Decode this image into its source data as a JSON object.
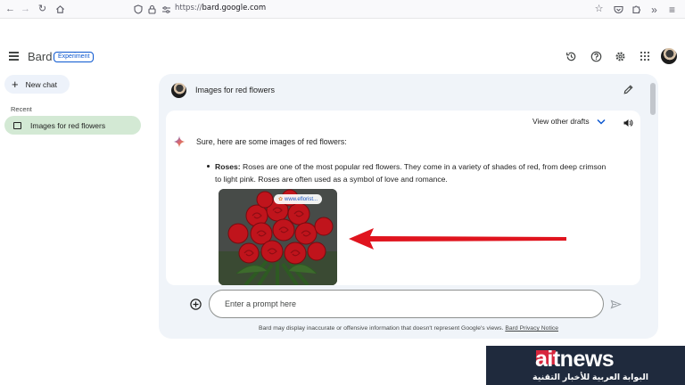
{
  "browser": {
    "url_prefix": "https://",
    "url_host": "bard.google.com",
    "icons": [
      "back-icon",
      "forward-icon",
      "reload-icon",
      "home-icon",
      "shield-icon",
      "lock-icon",
      "permissions-icon",
      "bookmark-star-icon",
      "pocket-icon",
      "extensions-icon",
      "overflow-icon",
      "menu-icon"
    ]
  },
  "header": {
    "brand": "Bard",
    "badge": "Experiment",
    "icons": [
      "history-icon",
      "help-icon",
      "settings-icon",
      "apps-grid-icon",
      "avatar"
    ]
  },
  "sidebar": {
    "new_chat_label": "New chat",
    "recent_label": "Recent",
    "items": [
      {
        "label": "Images for red flowers",
        "selected": true
      }
    ]
  },
  "conversation": {
    "prompt_text": "Images for red flowers",
    "view_drafts_label": "View other drafts",
    "response_intro": "Sure, here are some images of red flowers:",
    "bullets": [
      {
        "title": "Roses:",
        "text": " Roses are one of the most popular red flowers. They come in a variety of shades of red, from deep crimson to light pink. Roses are often used as a symbol of love and romance.",
        "image_source": "www.eflorist..."
      }
    ]
  },
  "input": {
    "placeholder": "Enter a prompt here"
  },
  "footer": {
    "disclaimer": "Bard may display inaccurate or offensive information that doesn't represent Google's views. ",
    "privacy_link": "Bard Privacy Notice"
  },
  "watermark": {
    "title": "aitnews",
    "subtitle": "البوابة العربية للأخبار التقنية"
  },
  "colors": {
    "accent_blue": "#0b57d0",
    "selected_chat_bg": "#d3e9d4",
    "panel_bg": "#f0f4f9",
    "annotation_arrow": "#e0141e"
  }
}
